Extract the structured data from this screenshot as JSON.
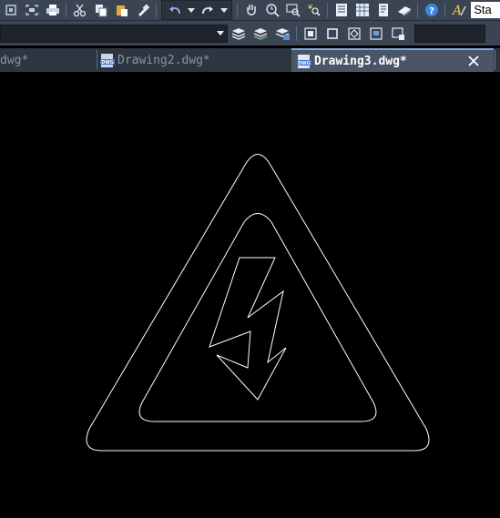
{
  "toolbar": {
    "style_label": "Sta",
    "icons": [
      "zoom-extents-icon",
      "zoom-window-icon",
      "print-icon",
      "cut-icon",
      "copy-icon",
      "paste-icon",
      "match-properties-icon",
      "undo-icon",
      "redo-icon",
      "pan-icon",
      "zoom-realtime-icon",
      "zoom-window2-icon",
      "zoom-previous-icon",
      "properties-icon",
      "design-center-icon",
      "tool-palettes-icon",
      "sheet-set-icon",
      "help-icon",
      "text-style-icon"
    ]
  },
  "layer_toolbar": {
    "icons": [
      "layer-properties-icon",
      "layer-previous-icon",
      "layer-states-icon",
      "make-current-icon",
      "block-icon",
      "insert-icon",
      "point-icon",
      "region-icon"
    ]
  },
  "tabs": [
    {
      "label": "dwg*",
      "active": false
    },
    {
      "label": "Drawing2.dwg*",
      "active": false
    },
    {
      "label": "Drawing3.dwg*",
      "active": true
    }
  ],
  "drawing": {
    "description_colors": {
      "background": "#000000",
      "stroke": "#ffffff"
    }
  }
}
